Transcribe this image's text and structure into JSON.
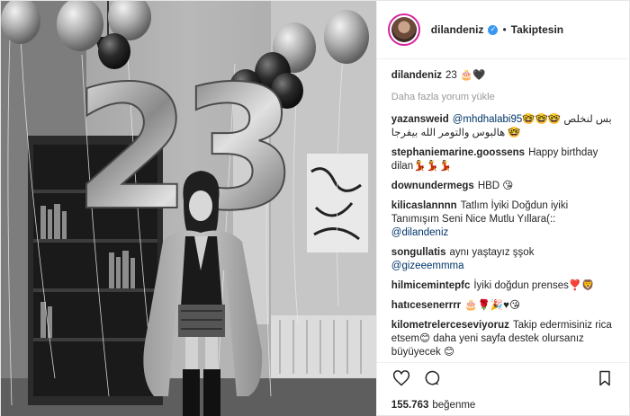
{
  "header": {
    "username": "dilandeniz",
    "separator": "•",
    "follow_status": "Takiptesin",
    "verified_icon": "verified-badge-icon",
    "colors": {
      "verified": "#3897f0",
      "ring": "#d6249f"
    }
  },
  "caption": {
    "username": "dilandeniz",
    "text": "23 🎂🖤"
  },
  "load_more": "Daha fazla yorum yükle",
  "comments": [
    {
      "username": "yazansweid",
      "mention": "@mhdhalabi95",
      "text": " بس لنخلص 🤓🤓🤓🤓 هالبوس والتومر الله بيفرجا",
      "mention_after": ""
    },
    {
      "username": "stephaniemarine.goossens",
      "mention": "",
      "text": "Happy birthday dilan💃💃💃",
      "mention_after": ""
    },
    {
      "username": "downundermegs",
      "mention": "",
      "text": "HBD 😘",
      "mention_after": ""
    },
    {
      "username": "kilicaslannnn",
      "mention": "",
      "text": "Tatlım İyiki Doğdun iyiki Tanımışım Seni Nice Mutlu Yıllara(::",
      "mention_after": "@dilandeniz"
    },
    {
      "username": "songullatis",
      "mention": "",
      "text": "aynı yaştayız şşok",
      "mention_after": "@gizeeemmma"
    },
    {
      "username": "hilmicemintepfc",
      "mention": "",
      "text": "İyiki doğdun prenses❣️🦁",
      "mention_after": ""
    },
    {
      "username": "hatıcesenerrrr",
      "mention": "",
      "text": "🎂🌹🎉♥😘",
      "mention_after": ""
    },
    {
      "username": "kilometrelerceseviyoruz",
      "mention": "",
      "text": "Takip edermisiniz rica etsem😊 daha yeni sayfa destek olursanız büyüyecek 😊",
      "mention_after": ""
    }
  ],
  "actions": {
    "like_icon": "heart-icon",
    "comment_icon": "comment-icon",
    "save_icon": "bookmark-icon"
  },
  "likes": {
    "count": "155.763",
    "label": "beğenme"
  },
  "photo": {
    "balloon_numbers": "23"
  }
}
